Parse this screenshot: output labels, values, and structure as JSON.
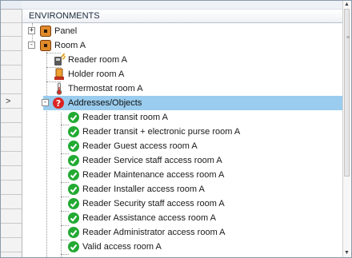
{
  "header": {
    "title": "ENVIRONMENTS"
  },
  "tree": {
    "panel": {
      "label": "Panel",
      "expander": "+",
      "icon": "panel-icon"
    },
    "room_a": {
      "label": "Room A",
      "expander": "-",
      "icon": "room-icon",
      "children": [
        {
          "label": "Reader room A",
          "icon": "reader-icon"
        },
        {
          "label": "Holder room A",
          "icon": "holder-icon"
        },
        {
          "label": "Thermostat room A",
          "icon": "thermostat-icon"
        }
      ]
    },
    "addresses": {
      "label": "Addresses/Objects",
      "expander": "-",
      "icon": "error-icon",
      "selected": true,
      "items": [
        "Reader transit room A",
        "Reader transit + electronic purse room A",
        "Reader Guest access room A",
        "Reader Service staff access room A",
        "Reader Maintenance access room A",
        "Reader Installer access room A",
        "Reader Security staff access room A",
        "Reader Assistance access room A",
        "Reader Administrator access room A",
        "Valid access room A"
      ],
      "item_icon": "check-icon"
    }
  },
  "row_header": {
    "current_row_marker": ">"
  },
  "scrollbar": {
    "up": "▲",
    "down": "▼"
  },
  "colors": {
    "selection": "#99ccee",
    "check": "#22aa33",
    "error": "#dd2222",
    "panel_icon": "#e08a2a"
  }
}
